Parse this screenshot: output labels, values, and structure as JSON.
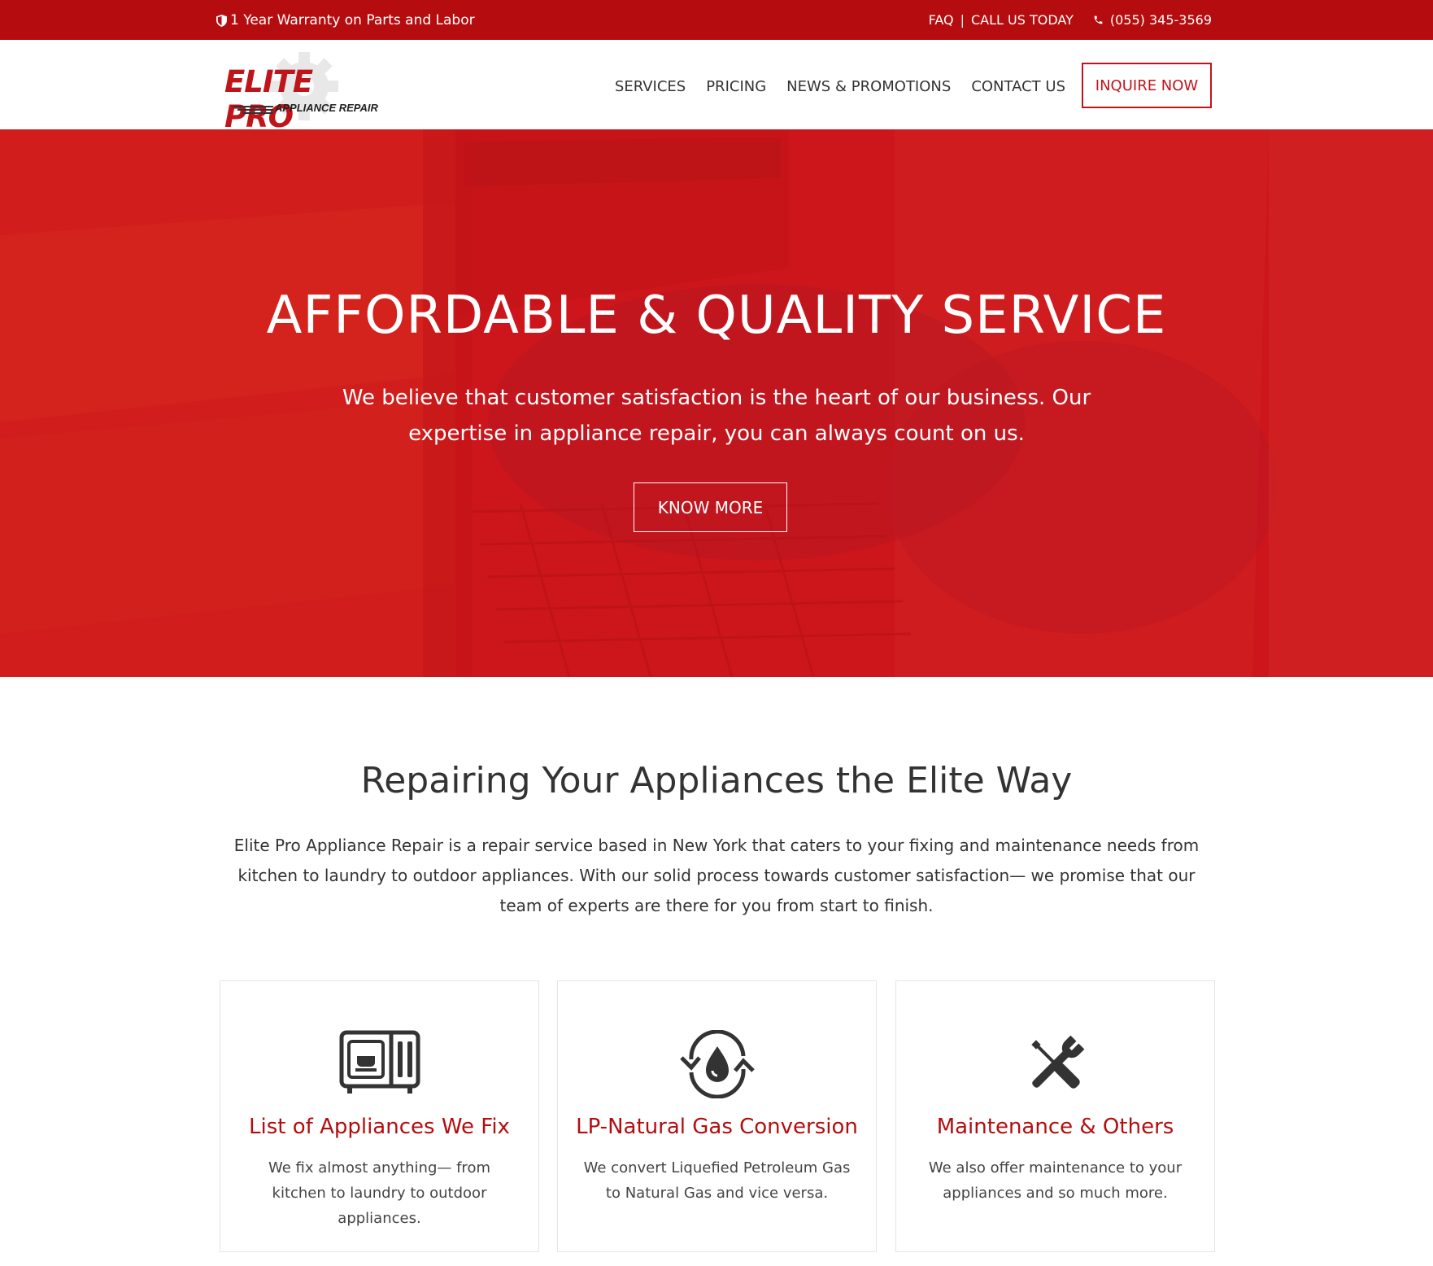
{
  "topbar": {
    "warranty": "1 Year Warranty on Parts and Labor",
    "faq": "FAQ",
    "separator": "|",
    "call_label": "CALL US TODAY",
    "phone": "(055) 345-3569"
  },
  "header": {
    "logo_main": "ELITE PRO",
    "logo_sub": "APPLIANCE REPAIR",
    "nav": [
      "SERVICES",
      "PRICING",
      "NEWS & PROMOTIONS",
      "CONTACT US"
    ],
    "cta": "INQUIRE NOW"
  },
  "hero": {
    "title": "AFFORDABLE & QUALITY SERVICE",
    "text": "We believe that customer satisfaction is the heart of our business. Our expertise in appliance repair, you can always count on us.",
    "button": "KNOW MORE"
  },
  "about": {
    "title": "Repairing Your Appliances the Elite Way",
    "text": "Elite Pro Appliance Repair is a repair service based in New York that caters to your fixing and maintenance needs from kitchen to laundry to outdoor appliances. With our solid process towards customer satisfaction— we promise that our team of experts are there for you from start to finish."
  },
  "cards": [
    {
      "icon": "appliance-icon",
      "title": "List of Appliances We Fix",
      "text": "We fix almost anything— from kitchen to laundry to outdoor appliances."
    },
    {
      "icon": "gas-conversion-icon",
      "title": "LP-Natural Gas Conversion",
      "text": "We convert Liquefied Petroleum Gas to Natural Gas and vice versa."
    },
    {
      "icon": "tools-icon",
      "title": "Maintenance & Others",
      "text": "We also offer maintenance to your appliances and so much more."
    }
  ],
  "colors": {
    "brand_red": "#b50d0f",
    "text_dark": "#333333"
  }
}
